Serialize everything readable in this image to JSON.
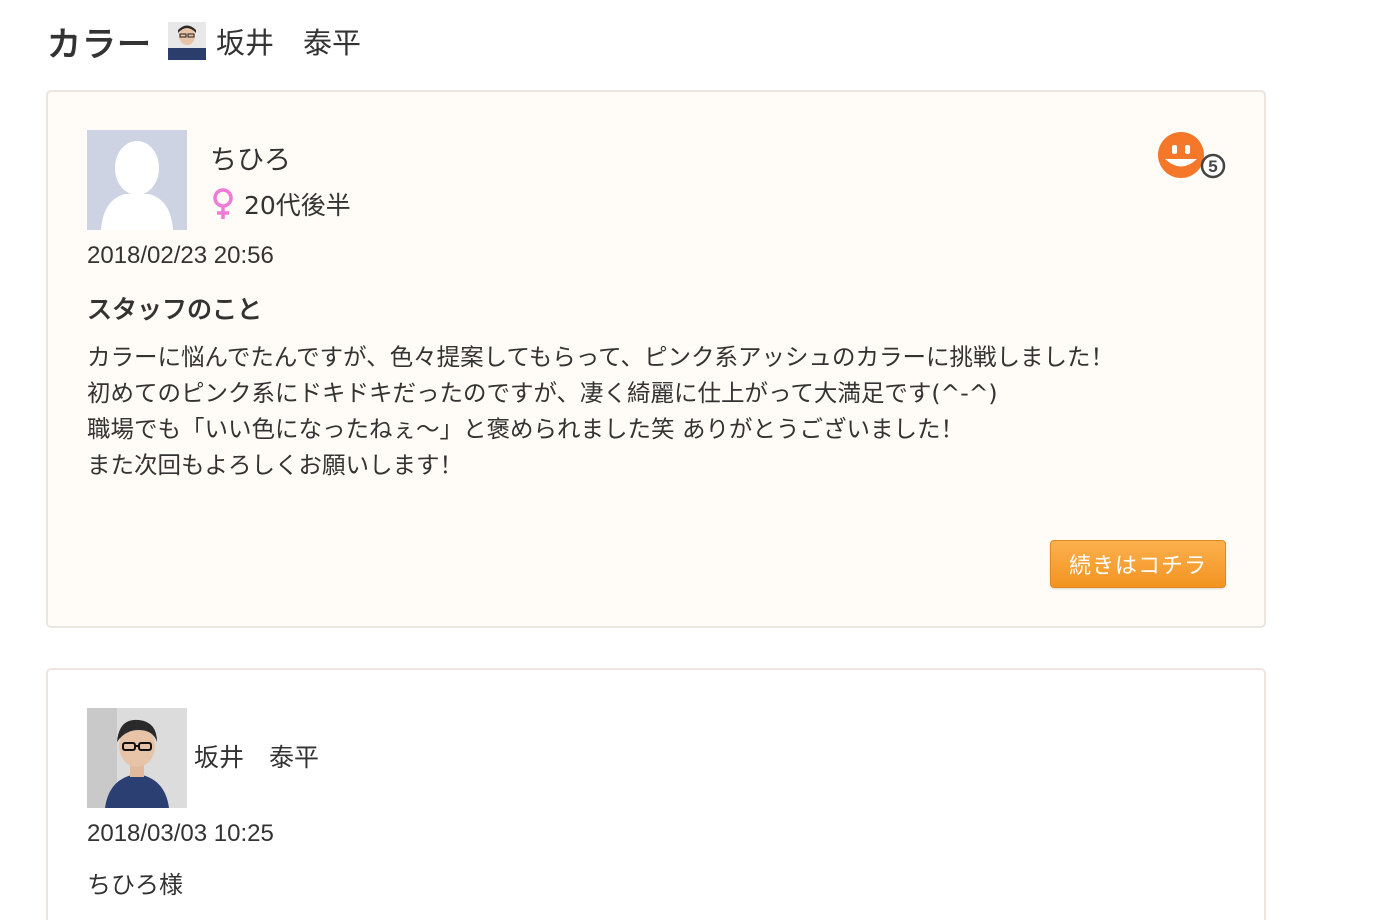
{
  "header": {
    "category": "カラー",
    "stylist_name": "坂井　泰平"
  },
  "review": {
    "reviewer_name": "ちひろ",
    "reviewer_age": "20代後半",
    "date": "2018/02/23 20:56",
    "rating": "5",
    "title": "スタッフのこと",
    "body_lines": [
      "カラーに悩んでたんですが、色々提案してもらって、ピンク系アッシュのカラーに挑戦しました！",
      "初めてのピンク系にドキドキだったのですが、凄く綺麗に仕上がって大満足です(^-^)",
      "職場でも「いい色になったねぇ〜」と褒められました笑 ありがとうございました！",
      "また次回もよろしくお願いします！"
    ],
    "more_label": "続きはコチラ"
  },
  "reply": {
    "stylist_name": "坂井　泰平",
    "date": "2018/03/03 10:25",
    "body_first_line": "ちひろ様"
  },
  "colors": {
    "accent_orange": "#f39321",
    "card_background": "#fffbf6",
    "female_pink": "#f07ad6"
  }
}
